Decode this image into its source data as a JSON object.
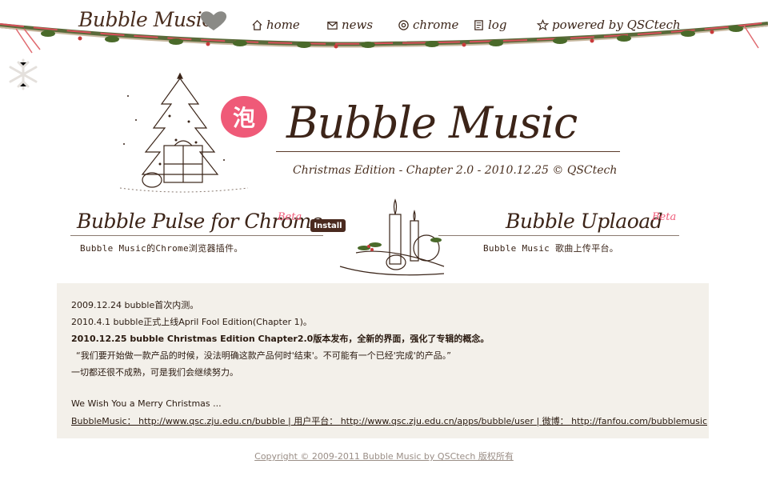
{
  "header": {
    "logo_text": "Bubble Music",
    "nav": [
      {
        "label": "home",
        "icon": "home-icon"
      },
      {
        "label": "news",
        "icon": "mail-icon"
      },
      {
        "label": "chrome",
        "icon": "chrome-icon"
      },
      {
        "label": "log",
        "icon": "notebook-icon"
      },
      {
        "label": "powered by QSCtech",
        "icon": "star-icon"
      }
    ]
  },
  "hero": {
    "badge": "泡",
    "title": "Bubble Music",
    "subtitle": "Christmas Edition - Chapter 2.0 - 2010.12.25 © QSCtech"
  },
  "products": {
    "pulse": {
      "title": "Bubble Pulse for Chrome",
      "beta": "Beta",
      "description": "Bubble Music的Chrome浏览器插件。",
      "install_label": "Install"
    },
    "upload": {
      "title": "Bubble Uplaoad",
      "beta": "Beta",
      "description": "Bubble Music 歌曲上传平台。"
    }
  },
  "info": {
    "line1": "2009.12.24 bubble首次内测。",
    "line2": "2010.4.1 bubble正式上线April Fool Edition(Chapter 1)。",
    "line3": "2010.12.25 bubble Christmas Edition Chapter2.0版本发布，全新的界面，强化了专辑的概念。",
    "line4": "“我们要开始做一款产品的时候，没法明确这款产品何时'结束'。不可能有一个已经'完成'的产品。”",
    "line5": "一切都还很不成熟，可是我们会继续努力。",
    "wish": "We Wish You a Merry Christmas ...",
    "links_line": "BubbleMusic： http://www.qsc.zju.edu.cn/bubble | 用户平台： http://www.qsc.zju.edu.cn/apps/bubble/user | 微博： http://fanfou.com/bubblemusic"
  },
  "footer": {
    "copyright": "Copyright © 2009-2011 Bubble Music by QSCtech 版权所有"
  },
  "colors": {
    "accent_pink": "#ef5a78",
    "text_brown": "#3c2418",
    "info_bg": "#f3f0ea",
    "install_bg": "#4a2a1f"
  }
}
